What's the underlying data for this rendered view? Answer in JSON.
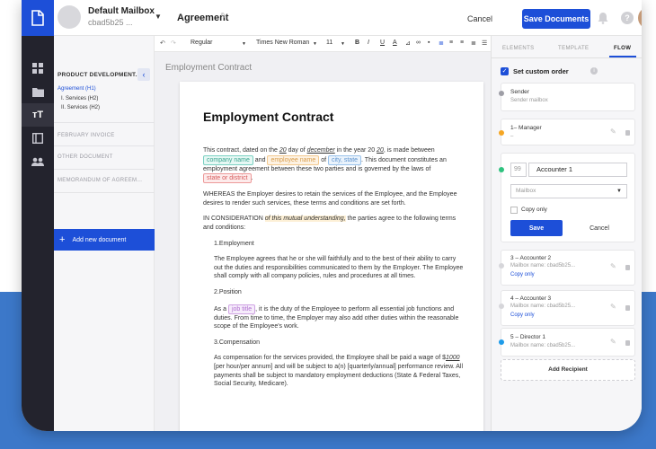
{
  "topbar": {
    "mailbox_name": "Default Mailbox",
    "mailbox_sub": "cbad5b25 ...",
    "doc_title": "Agreement",
    "cancel_label": "Cancel",
    "save_label": "Save Documents",
    "help_glyph": "?"
  },
  "toolbar": {
    "style": "Regular",
    "font": "Times New Roman",
    "size": "11",
    "bold": "B",
    "italic": "I",
    "underline": "U",
    "font_color": "A"
  },
  "sidebar": {
    "section_title": "PRODUCT DEVELOPMENT...",
    "items": [
      {
        "label": "Agreement (H1)"
      },
      {
        "label": "I. Services (H2)"
      },
      {
        "label": "II. Services (H2)"
      }
    ],
    "other_docs": [
      "FEBRUARY INVOICE",
      "OTHER DOCUMENT",
      "MEMORANDUM OF AGREEM..."
    ],
    "add_label": "Add new document"
  },
  "editor": {
    "header": "Employment Contract",
    "doc": {
      "title": "Employment Contract",
      "p1": {
        "a": "This contract, dated on the ",
        "day": "20",
        "b": " day of ",
        "month": "december",
        "c": " in the year 20 ",
        "yr": "20",
        "d": ", is made between ",
        "company": "company name",
        "e": " and ",
        "employee": "employee name",
        "f": " of ",
        "city": "city, state",
        "g": ". This document constitutes an employment agreement between these two parties and is governed by the laws of ",
        "state": "state or district",
        "h": "."
      },
      "p2": "WHEREAS the Employer desires to retain the services of the Employee, and the Employee desires to render such services, these terms and conditions are set forth.",
      "p3": {
        "a": "IN CONSIDERATION ",
        "hl": "of this mutual understanding,",
        "b": " the parties agree to the following terms and conditions:"
      },
      "s1_title": "1.Employment",
      "s1_text": "The Employee agrees that he or she will faithfully and to the best of their ability to carry out the duties and responsibilities communicated to them by the Employer. The Employee shall comply with all company policies, rules and procedures at all times.",
      "s2_title": "2.Position",
      "s2": {
        "a": "As a ",
        "job": "job title",
        "b": ", it is the duty of the Employee to perform all essential job functions and duties. From time to time, the Employer may also add other duties within the reasonable scope of the Employee's work."
      },
      "s3_title": "3.Compensation",
      "s3": {
        "a": "As compensation for the services provided, the Employee shall be paid a wage of $",
        "amt": "1000",
        "b": " [per hour/per annum] and will be subject to a(n) [quarterly/annual] performance review. All payments shall be subject to mandatory employment deductions (State & Federal Taxes, Social Security, Medicare)."
      }
    }
  },
  "panel": {
    "tabs": [
      "ELEMENTS",
      "TEMPLATE",
      "FLOW"
    ],
    "custom_order_label": "Set custom order",
    "info_glyph": "i",
    "sender": {
      "title": "Sender",
      "sub": "Sender mailbox"
    },
    "manager": {
      "title": "1– Manager",
      "sub": "–"
    },
    "edit_card": {
      "number": "99",
      "name": "Accounter 1",
      "mailbox_placeholder": "Mailbox",
      "copy_only": "Copy only",
      "save": "Save",
      "cancel": "Cancel"
    },
    "recipients": [
      {
        "title": "3 – Accounter 2",
        "sub": "Mailbox name: cbad5b25...",
        "link": "Copy only"
      },
      {
        "title": "4 – Accounter 3",
        "sub": "Mailbox name: cbad5b25...",
        "link": "Copy only"
      },
      {
        "title": "5 – Director 1",
        "sub": "Mailbox name: cbad5b25..."
      }
    ],
    "add_recipient": "Add Recipient"
  },
  "colors": {
    "accent": "#1d4fd8",
    "rail": "#23232d",
    "background_band": "#3c78c9",
    "dot_sender": "#9e9ea6",
    "dot_manager": "#f5a623",
    "dot_accounter1": "#2ec27e",
    "dot_accounter": "#d6d6da",
    "dot_director": "#1e9be9"
  },
  "icons": [
    "document-logo-icon",
    "dashboard-icon",
    "folder-icon",
    "text-tool-icon",
    "layout-icon",
    "users-icon",
    "bell-icon",
    "help-icon",
    "edit-icon",
    "trash-icon",
    "chevron-left-icon"
  ]
}
